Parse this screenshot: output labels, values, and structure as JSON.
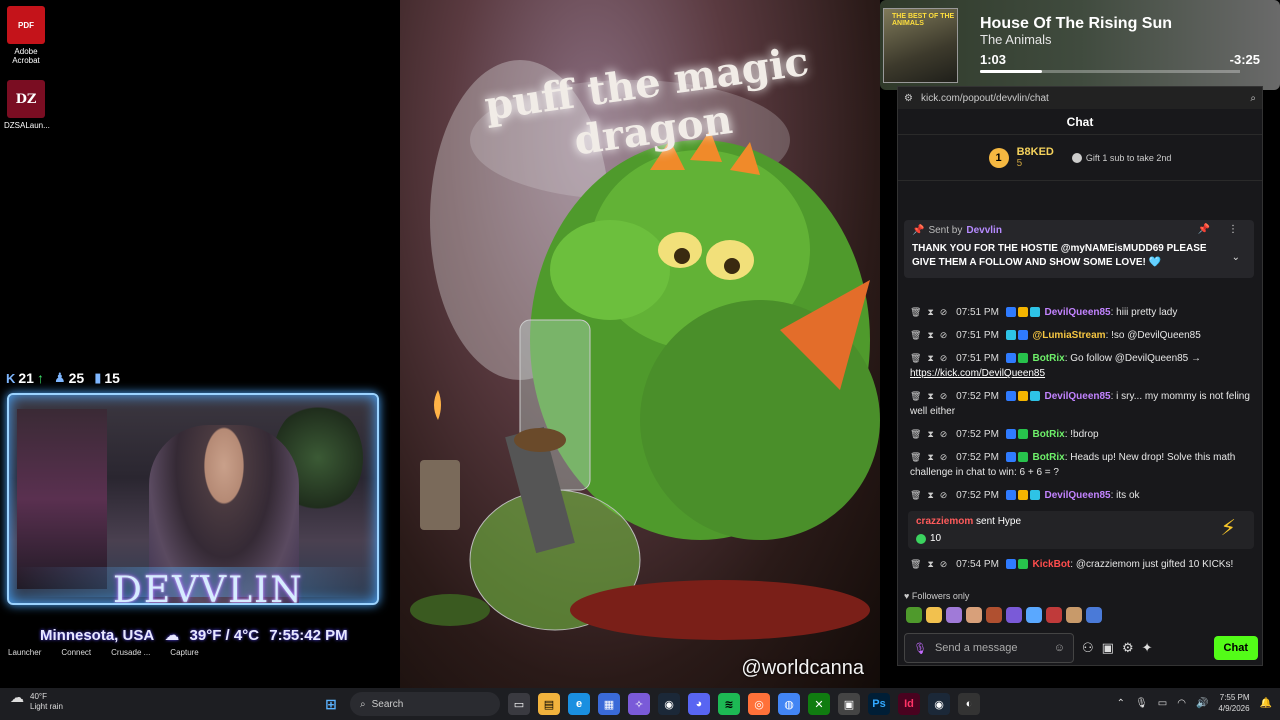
{
  "desktop": {
    "icons": [
      {
        "label": "Adobe Acrobat",
        "glyph": "PDF"
      },
      {
        "label": "DZSALaun...",
        "glyph": "DZ"
      }
    ]
  },
  "overlay": {
    "counters": {
      "kick_followers": "21",
      "followers": "25",
      "viewers": "15"
    },
    "cam_logo": "DEVVLIN",
    "location": "Minnesota, USA",
    "temperature": "39°F / 4°C",
    "time": "7:55:42 PM",
    "taskrow": [
      "Launcher",
      "Connect",
      "Crusade ...",
      "Capture"
    ]
  },
  "art": {
    "title": "puff the magic dragon",
    "credit": "@worldcanna"
  },
  "music": {
    "album_label": "THE BEST OF THE ANIMALS",
    "song": "House Of The Rising Sun",
    "artist": "The Animals",
    "elapsed": "1:03",
    "remaining": "-3:25",
    "progress": 0.24
  },
  "chat": {
    "url": "kick.com/popout/devvlin/chat",
    "header": "Chat",
    "leaderboard": {
      "rank": "1",
      "name": "B8KED",
      "count": "5",
      "gift_text": "Gift 1 sub to take 2nd"
    },
    "pinned": {
      "sent_by": "Sent by",
      "author": "Devvlin",
      "message": "THANK YOU FOR THE HOSTIE @myNAMEisMUDD69 PLEASE GIVE THEM A FOLLOW AND SHOW SOME LOVE! 🩵"
    },
    "messages": [
      {
        "time": "07:51 PM",
        "user": "DevilQueen85",
        "color": "pink",
        "text": ": hiii pretty lady"
      },
      {
        "time": "07:51 PM",
        "user": "@LumiaStream",
        "color": "gold",
        "text": ": !so @DevilQueen85"
      },
      {
        "time": "07:51 PM",
        "user": "BotRix",
        "color": "green",
        "text": ": Go follow @DevilQueen85 →",
        "link": "https://kick.com/DevilQueen85"
      },
      {
        "time": "07:52 PM",
        "user": "DevilQueen85",
        "color": "pink",
        "text": ": i sry... my mommy is not feling well either"
      },
      {
        "time": "07:52 PM",
        "user": "BotRix",
        "color": "green",
        "text": ": !bdrop"
      },
      {
        "time": "07:52 PM",
        "user": "BotRix",
        "color": "green",
        "text": ": Heads up! New drop! Solve this math challenge in chat to win: 6 + 6 = ?"
      },
      {
        "time": "07:52 PM",
        "user": "DevilQueen85",
        "color": "pink",
        "text": ": its ok"
      }
    ],
    "hype": {
      "user": "crazziemom",
      "action": " sent Hype",
      "amount": "10"
    },
    "last_message": {
      "time": "07:54 PM",
      "user": "KickBot",
      "color": "red",
      "text": ": @crazziemom just gifted 10 KICKs!"
    },
    "followers_only": "Followers only",
    "input_placeholder": "Send a message",
    "send_label": "Chat"
  },
  "taskbar": {
    "weather_temp": "40°F",
    "weather_desc": "Light rain",
    "search_placeholder": "Search",
    "clock_time": "7:55 PM",
    "clock_date": "4/9/2026"
  },
  "colors": {
    "kick_green": "#53fc18",
    "chat_bg": "#18181b",
    "taskbar_bg": "#1d1e22"
  }
}
